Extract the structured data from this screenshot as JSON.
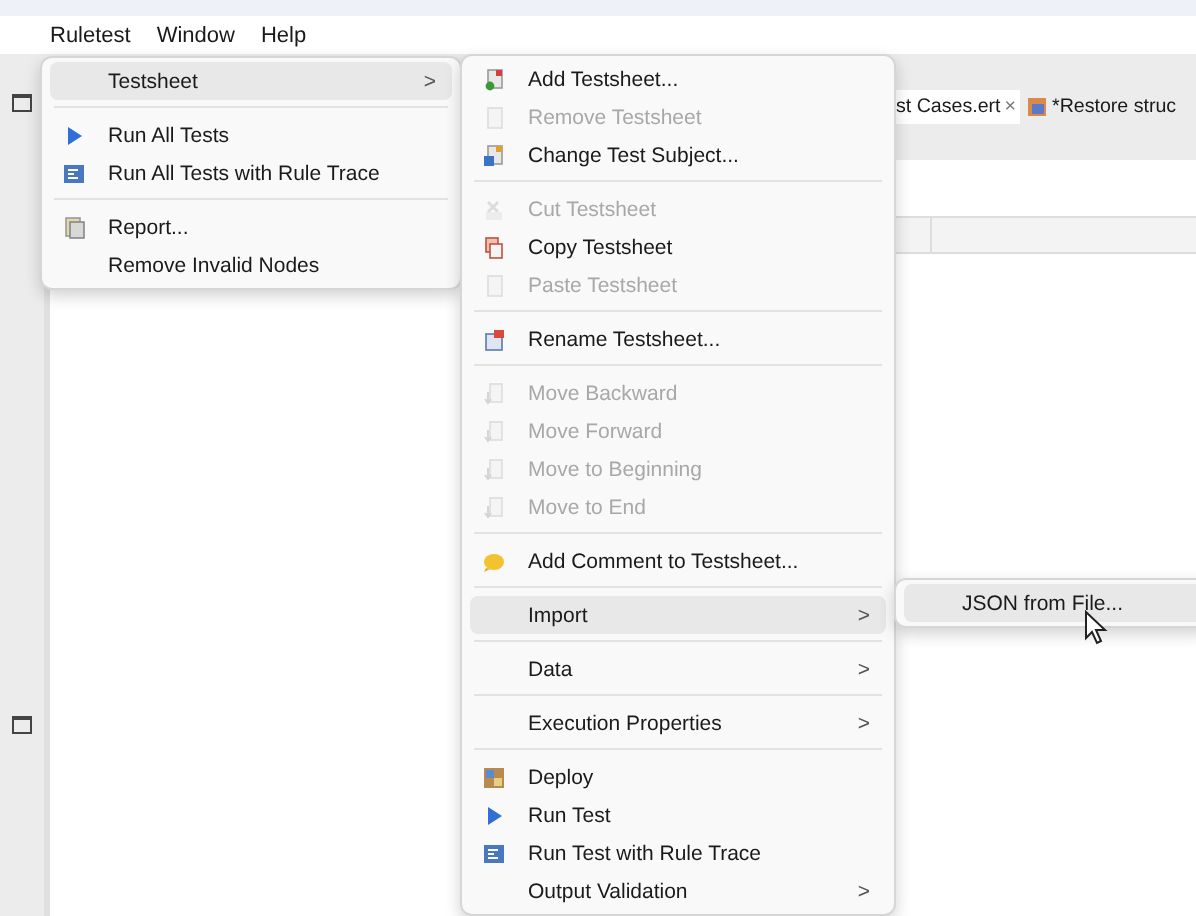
{
  "menubar": [
    {
      "label": "Ruletest"
    },
    {
      "label": "Window"
    },
    {
      "label": "Help"
    }
  ],
  "editor_tabs": [
    {
      "label": "st Cases.ert",
      "close": "×"
    },
    {
      "label": "*Restore struc"
    }
  ],
  "menus": [
    {
      "items": [
        {
          "kind": "item",
          "label": "Testsheet",
          "arrow": ">",
          "selected": true,
          "disabled": false
        },
        {
          "kind": "separator"
        },
        {
          "kind": "item",
          "label": "Run All Tests",
          "selected": false,
          "disabled": false
        },
        {
          "kind": "item",
          "label": "Run All Tests with Rule Trace",
          "selected": false,
          "disabled": false
        },
        {
          "kind": "separator"
        },
        {
          "kind": "item",
          "label": "Report...",
          "selected": false,
          "disabled": false
        },
        {
          "kind": "item",
          "label": "Remove Invalid Nodes",
          "selected": false,
          "disabled": false
        }
      ]
    },
    {
      "items": [
        {
          "kind": "item",
          "label": "Add Testsheet...",
          "selected": false,
          "disabled": false
        },
        {
          "kind": "item",
          "label": "Remove Testsheet",
          "selected": false,
          "disabled": true
        },
        {
          "kind": "item",
          "label": "Change Test Subject...",
          "selected": false,
          "disabled": false
        },
        {
          "kind": "separator"
        },
        {
          "kind": "item",
          "label": "Cut Testsheet",
          "selected": false,
          "disabled": true
        },
        {
          "kind": "item",
          "label": "Copy Testsheet",
          "selected": false,
          "disabled": false
        },
        {
          "kind": "item",
          "label": "Paste Testsheet",
          "selected": false,
          "disabled": true
        },
        {
          "kind": "separator"
        },
        {
          "kind": "item",
          "label": "Rename Testsheet...",
          "selected": false,
          "disabled": false
        },
        {
          "kind": "separator"
        },
        {
          "kind": "item",
          "label": "Move Backward",
          "selected": false,
          "disabled": true
        },
        {
          "kind": "item",
          "label": "Move Forward",
          "selected": false,
          "disabled": true
        },
        {
          "kind": "item",
          "label": "Move to Beginning",
          "selected": false,
          "disabled": true
        },
        {
          "kind": "item",
          "label": "Move to End",
          "selected": false,
          "disabled": true
        },
        {
          "kind": "separator"
        },
        {
          "kind": "item",
          "label": "Add Comment to Testsheet...",
          "selected": false,
          "disabled": false
        },
        {
          "kind": "separator"
        },
        {
          "kind": "item",
          "label": "Import",
          "arrow": ">",
          "selected": true,
          "disabled": false
        },
        {
          "kind": "separator"
        },
        {
          "kind": "item",
          "label": "Data",
          "arrow": ">",
          "selected": false,
          "disabled": false
        },
        {
          "kind": "separator"
        },
        {
          "kind": "item",
          "label": "Execution Properties",
          "arrow": ">",
          "selected": false,
          "disabled": false
        },
        {
          "kind": "separator"
        },
        {
          "kind": "item",
          "label": "Deploy",
          "selected": false,
          "disabled": false
        },
        {
          "kind": "item",
          "label": "Run Test",
          "selected": false,
          "disabled": false
        },
        {
          "kind": "item",
          "label": "Run Test with Rule Trace",
          "selected": false,
          "disabled": false
        },
        {
          "kind": "item",
          "label": "Output Validation",
          "arrow": ">",
          "selected": false,
          "disabled": false
        }
      ]
    },
    {
      "items": [
        {
          "kind": "item",
          "label": "JSON from File...",
          "selected": true,
          "disabled": false
        }
      ]
    }
  ]
}
